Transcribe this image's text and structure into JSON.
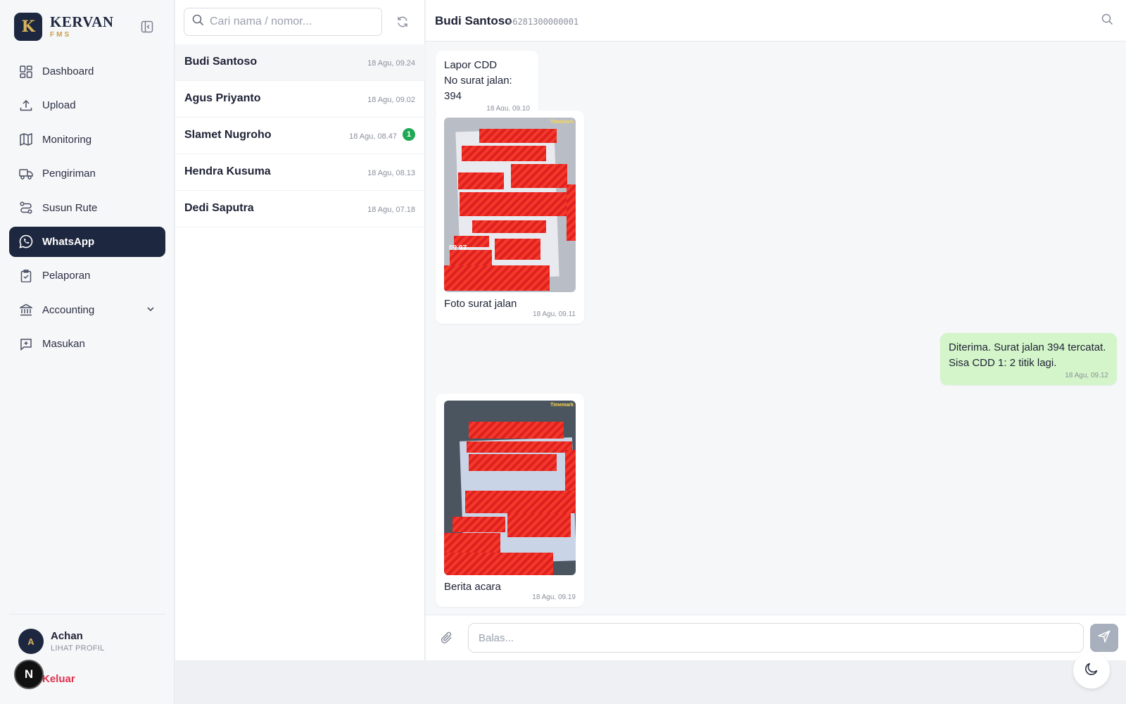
{
  "brand": {
    "logo_letter": "K",
    "name": "KERVAN",
    "sub": "FMS"
  },
  "nav": [
    {
      "label": "Dashboard",
      "icon": "dashboard-icon"
    },
    {
      "label": "Upload",
      "icon": "upload-icon"
    },
    {
      "label": "Monitoring",
      "icon": "map-icon"
    },
    {
      "label": "Pengiriman",
      "icon": "truck-icon"
    },
    {
      "label": "Susun Rute",
      "icon": "route-icon"
    },
    {
      "label": "WhatsApp",
      "icon": "whatsapp-icon",
      "active": true
    },
    {
      "label": "Pelaporan",
      "icon": "clipboard-icon"
    },
    {
      "label": "Accounting",
      "icon": "bank-icon",
      "has_submenu": true
    },
    {
      "label": "Masukan",
      "icon": "feedback-icon"
    }
  ],
  "profile": {
    "initial": "A",
    "name": "Achan",
    "link": "LIHAT PROFIL",
    "logout": "Keluar"
  },
  "n_badge": "N",
  "search": {
    "placeholder": "Cari nama / nomor..."
  },
  "conversations": [
    {
      "name": "Budi Santoso",
      "time": "18 Agu, 09.24",
      "active": true
    },
    {
      "name": "Agus Priyanto",
      "time": "18 Agu, 09.02"
    },
    {
      "name": "Slamet Nugroho",
      "time": "18 Agu, 08.47",
      "unread": "1"
    },
    {
      "name": "Hendra Kusuma",
      "time": "18 Agu, 08.13"
    },
    {
      "name": "Dedi Saputra",
      "time": "18 Agu, 07.18"
    }
  ],
  "chat": {
    "name": "Budi Santoso",
    "phone": "+6281300000001",
    "messages": [
      {
        "dir": "in",
        "text": "Lapor CDD\nNo surat jalan: 394",
        "time": "18 Agu, 09.10"
      },
      {
        "dir": "in",
        "caption": "Foto surat jalan",
        "time": "18 Agu, 09.11",
        "photo_watermark": "Timemark",
        "photo_clock": "09.07"
      },
      {
        "dir": "out",
        "text": "Diterima. Surat jalan 394 tercatat.\nSisa CDD 1: 2 titik lagi.",
        "time": "18 Agu, 09.12"
      },
      {
        "dir": "in",
        "caption": "Berita acara",
        "time": "18 Agu, 09.19",
        "photo_watermark": "Timemark"
      }
    ]
  },
  "composer": {
    "placeholder": "Balas..."
  },
  "colors": {
    "navy": "#1e2740",
    "gold": "#c9a046",
    "green_bubble": "#d4f5c9",
    "unread": "#1fa855",
    "logout": "#e0314b"
  }
}
